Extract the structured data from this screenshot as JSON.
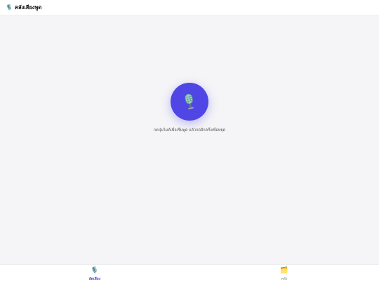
{
  "header": {
    "icon": "microphone-icon",
    "icon_glyph": "🎙️",
    "title": "คลังเสียงพูด"
  },
  "record": {
    "button_icon": "microphone-icon",
    "hint": "กดปุ่มไมค์เพื่อเริ่มพูด แล้วกดอีกครั้งเพื่อหยุด"
  },
  "tabs": [
    {
      "label": "อัดเสียง",
      "icon": "microphone-icon",
      "icon_glyph": "🎙️",
      "active": true
    },
    {
      "label": "คลัง",
      "icon": "folder-icon",
      "icon_glyph": "🗂️",
      "active": false
    }
  ],
  "colors": {
    "accent": "#4f46e5",
    "background": "#f5f5f7"
  }
}
